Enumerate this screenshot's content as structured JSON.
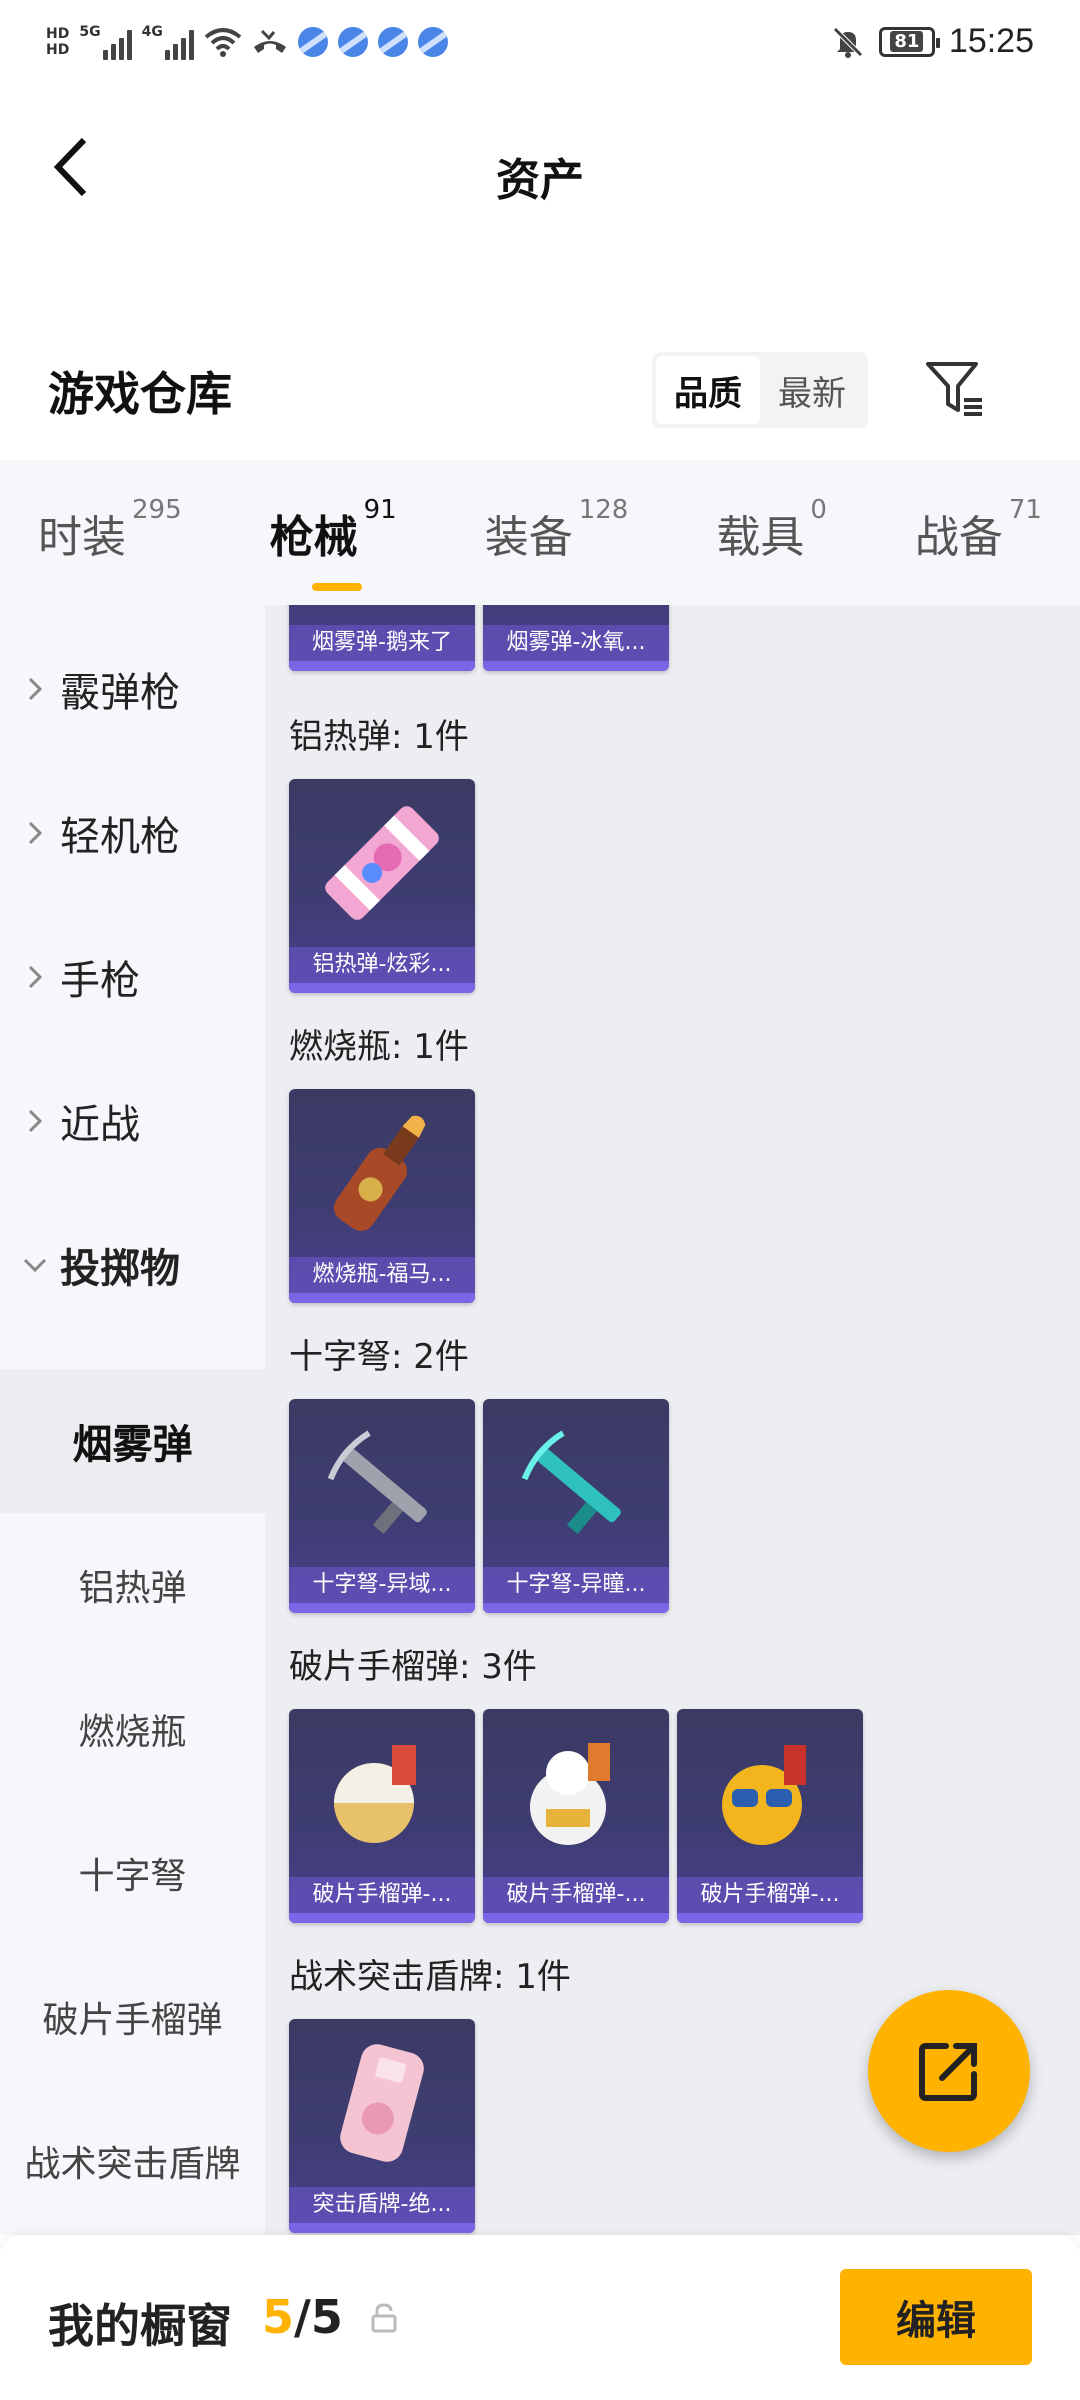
{
  "status_bar": {
    "time": "15:25",
    "battery": "81",
    "hd1": "HD",
    "hd2": "HD",
    "net1": "5G",
    "net2": "4G"
  },
  "header": {
    "title": "资产",
    "back_icon": "chevron-left-icon"
  },
  "section": {
    "title": "游戏仓库",
    "sort_options": [
      "品质",
      "最新"
    ],
    "active_sort": "品质",
    "filter_icon": "filter-icon"
  },
  "tabs": [
    {
      "label": "时装",
      "count": "295"
    },
    {
      "label": "枪械",
      "count": "91"
    },
    {
      "label": "装备",
      "count": "128"
    },
    {
      "label": "载具",
      "count": "0"
    },
    {
      "label": "战备",
      "count": "71"
    }
  ],
  "active_tab": "枪械",
  "sidebar": {
    "categories": [
      "霰弹枪",
      "轻机枪",
      "手枪",
      "近战",
      "投掷物"
    ],
    "subcategories": [
      "烟雾弹",
      "铝热弹",
      "燃烧瓶",
      "十字弩",
      "破片手榴弹",
      "战术突击盾牌"
    ],
    "active_sub": "烟雾弹"
  },
  "content": {
    "top_cards": [
      "烟雾弹-鹅来了",
      "烟雾弹-冰氧..."
    ],
    "groups": [
      {
        "label": "铝热弹: 1件",
        "items": [
          "铝热弹-炫彩..."
        ]
      },
      {
        "label": "燃烧瓶: 1件",
        "items": [
          "燃烧瓶-福马..."
        ]
      },
      {
        "label": "十字弩: 2件",
        "items": [
          "十字弩-异域...",
          "十字弩-异瞳..."
        ]
      },
      {
        "label": "破片手榴弹: 3件",
        "items": [
          "破片手榴弹-...",
          "破片手榴弹-...",
          "破片手榴弹-..."
        ]
      },
      {
        "label": "战术突击盾牌: 1件",
        "items": [
          "突击盾牌-绝..."
        ]
      }
    ]
  },
  "bottom_bar": {
    "label": "我的橱窗",
    "current": "5",
    "separator": "/",
    "total": "5",
    "edit_label": "编辑"
  },
  "colors": {
    "accent": "#ffb300",
    "card_bg": "#3e3d72",
    "card_strip": "#7b66e8"
  }
}
